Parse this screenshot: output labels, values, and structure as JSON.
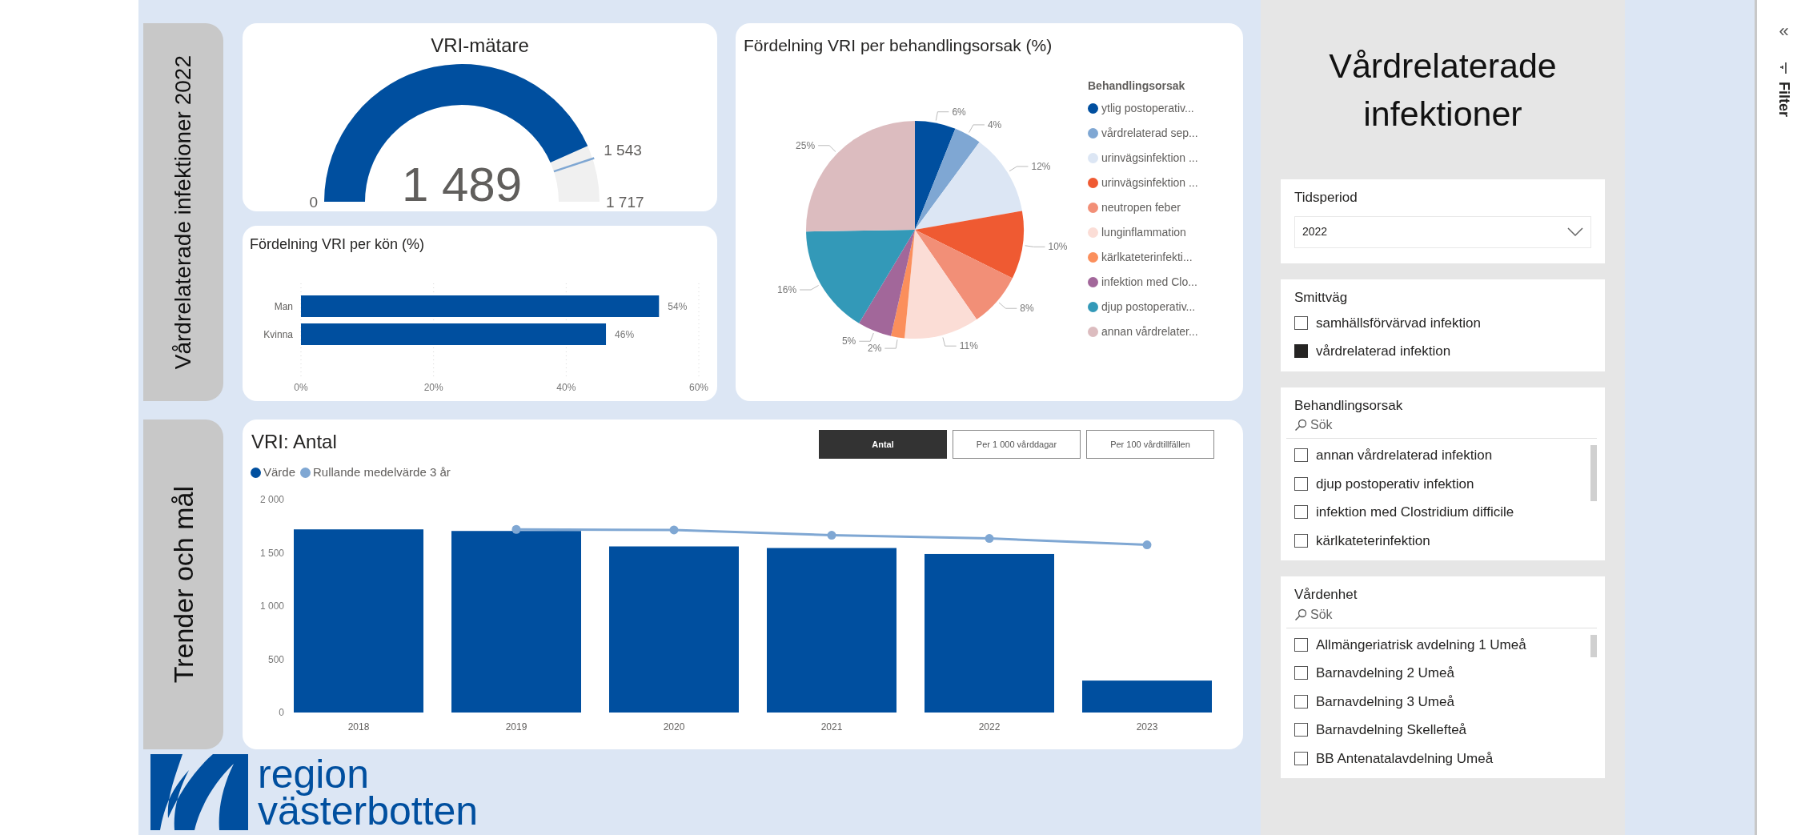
{
  "sections": [
    {
      "label": "Vårdrelaterade infektioner 2022"
    },
    {
      "label": "Trender och mål"
    }
  ],
  "gauge": {
    "title": "VRI-mätare",
    "value": "1 489",
    "min": "0",
    "target": "1 543",
    "max": "1 717"
  },
  "gender_chart": {
    "title": "Fördelning VRI per kön (%)",
    "chart_data": {
      "type": "bar",
      "orientation": "horizontal",
      "categories": [
        "Man",
        "Kvinna"
      ],
      "series": [
        {
          "color": "#004f9f",
          "values": [
            54,
            46
          ]
        }
      ],
      "xlim": [
        0,
        60
      ],
      "xticks": [
        {
          "value": 0,
          "label": "0%"
        },
        {
          "value": 20,
          "label": "20%"
        },
        {
          "value": 40,
          "label": "40%"
        },
        {
          "value": 60,
          "label": "60%"
        }
      ],
      "value_labels": [
        "54%",
        "46%"
      ]
    }
  },
  "pie_chart": {
    "title": "Fördelning VRI per behandlingsorsak (%)",
    "legend_title": "Behandlingsorsak",
    "chart_data": {
      "type": "pie",
      "categories": [
        "ytlig postoperativ...",
        "vårdrelaterad sep...",
        "urinvägsinfektion ...",
        "urinvägsinfektion ...",
        "neutropen feber",
        "lunginflammation",
        "kärlkateterinfekti...",
        "infektion med Clo...",
        "djup postoperativ...",
        "annan vårdrelater..."
      ],
      "series": [
        {
          "colors": [
            "#004f9f",
            "#7fa7d3",
            "#dce6f4",
            "#ef5a32",
            "#f28f77",
            "#fbddd6",
            "#fb8f5c",
            "#a2679a",
            "#3399b8",
            "#dcbcbf"
          ],
          "values": [
            6,
            4,
            12,
            10,
            8,
            11,
            2,
            5,
            16,
            25
          ]
        }
      ],
      "value_labels": [
        "6%",
        "4%",
        "12%",
        "10%",
        "8%",
        "11%",
        "2%",
        "5%",
        "16%",
        "25%"
      ]
    }
  },
  "trend_chart": {
    "title": "VRI: Antal",
    "buttons": [
      {
        "label": "Antal",
        "selected": true
      },
      {
        "label": "Per 1 000 vårddagar",
        "selected": false
      },
      {
        "label": "Per 100 vårdtillfällen",
        "selected": false
      }
    ],
    "chart_data": {
      "type": "bar",
      "categories": [
        "2018",
        "2019",
        "2020",
        "2021",
        "2022",
        "2023"
      ],
      "series": [
        {
          "name": "Värde",
          "color": "#004f9f",
          "values": [
            1720,
            1705,
            1560,
            1545,
            1489,
            300
          ]
        },
        {
          "name": "Rullande medelvärde 3 år",
          "color": "#7fa7d3",
          "type": "line",
          "marker": true,
          "values": [
            null,
            1720,
            1715,
            1665,
            1635,
            1575
          ]
        }
      ],
      "ylim": [
        0,
        2000
      ],
      "yticks": [
        {
          "value": 0,
          "label": "0"
        },
        {
          "value": 500,
          "label": "500"
        },
        {
          "value": 1000,
          "label": "1 000"
        },
        {
          "value": 1500,
          "label": "1 500"
        },
        {
          "value": 2000,
          "label": "2 000"
        }
      ]
    }
  },
  "logo": {
    "lines": [
      "region",
      "västerbotten"
    ]
  },
  "panel": {
    "title": "Vårdrelaterade infektioner",
    "period": {
      "label": "Tidsperiod",
      "value": "2022"
    },
    "slicers": [
      {
        "label": "Smittväg",
        "items": [
          {
            "label": "samhällsförvärvad infektion",
            "checked": false
          },
          {
            "label": "vårdrelaterad infektion",
            "checked": true
          }
        ]
      },
      {
        "label": "Behandlingsorsak",
        "search": "Sök",
        "items": [
          {
            "label": "annan vårdrelaterad infektion",
            "checked": false
          },
          {
            "label": "djup postoperativ infektion",
            "checked": false
          },
          {
            "label": "infektion med Clostridium difficile",
            "checked": false
          },
          {
            "label": "kärlkateterinfektion",
            "checked": false
          }
        ]
      },
      {
        "label": "Vårdenhet",
        "search": "Sök",
        "items": [
          {
            "label": "Allmängeriatrisk avdelning 1 Umeå",
            "checked": false
          },
          {
            "label": "Barnavdelning 2 Umeå",
            "checked": false
          },
          {
            "label": "Barnavdelning 3 Umeå",
            "checked": false
          },
          {
            "label": "Barnavdelning Skellefteå",
            "checked": false
          },
          {
            "label": "BB Antenatalavdelning Umeå",
            "checked": false
          }
        ]
      }
    ]
  },
  "filter_pane": {
    "collapse": "«",
    "label": "Filter"
  }
}
